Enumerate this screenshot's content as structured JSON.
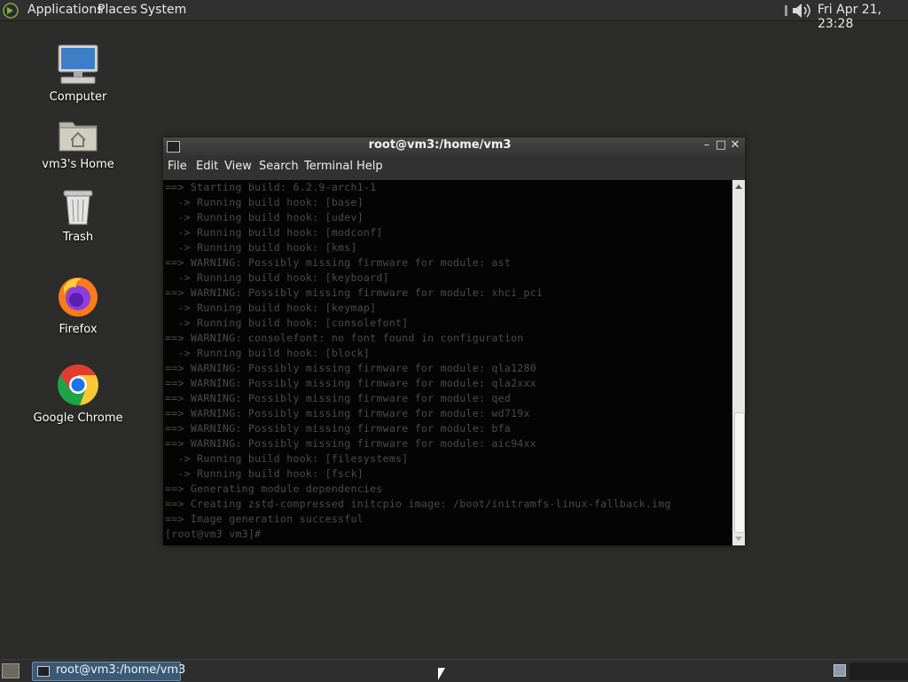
{
  "top_panel": {
    "menus": [
      "Applications",
      "Places",
      "System"
    ],
    "clock": "Fri Apr 21, 23:28"
  },
  "desktop_icons": [
    {
      "label": "Computer",
      "icon": "computer-icon"
    },
    {
      "label": "vm3's Home",
      "icon": "home-folder-icon"
    },
    {
      "label": "Trash",
      "icon": "trash-icon"
    },
    {
      "label": "Firefox",
      "icon": "firefox-icon"
    },
    {
      "label": "Google Chrome",
      "icon": "chrome-icon"
    }
  ],
  "terminal": {
    "title": "root@vm3:/home/vm3",
    "menu": [
      "File",
      "Edit",
      "View",
      "Search",
      "Terminal",
      "Help"
    ],
    "lines": [
      "==> Starting build: 6.2.9-arch1-1",
      "  -> Running build hook: [base]",
      "  -> Running build hook: [udev]",
      "  -> Running build hook: [modconf]",
      "  -> Running build hook: [kms]",
      "==> WARNING: Possibly missing firmware for module: ast",
      "  -> Running build hook: [keyboard]",
      "==> WARNING: Possibly missing firmware for module: xhci_pci",
      "  -> Running build hook: [keymap]",
      "  -> Running build hook: [consolefont]",
      "==> WARNING: consolefont: no font found in configuration",
      "  -> Running build hook: [block]",
      "==> WARNING: Possibly missing firmware for module: qla1280",
      "==> WARNING: Possibly missing firmware for module: qla2xxx",
      "==> WARNING: Possibly missing firmware for module: qed",
      "==> WARNING: Possibly missing firmware for module: wd719x",
      "==> WARNING: Possibly missing firmware for module: bfa",
      "==> WARNING: Possibly missing firmware for module: aic94xx",
      "  -> Running build hook: [filesystems]",
      "  -> Running build hook: [fsck]",
      "==> Generating module dependencies",
      "==> Creating zstd-compressed initcpio image: /boot/initramfs-linux-fallback.img",
      "==> Image generation successful",
      "[root@vm3 vm3]# "
    ]
  },
  "taskbar": {
    "task_label": "root@vm3:/home/vm3"
  }
}
